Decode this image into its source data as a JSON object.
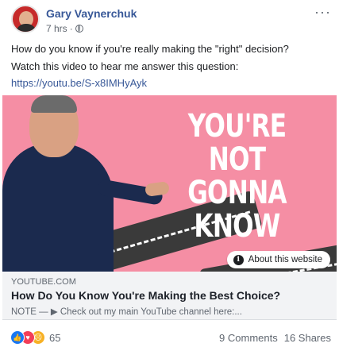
{
  "header": {
    "author": "Gary Vaynerchuk",
    "time": "7 hrs",
    "separator": "·",
    "more_label": "···"
  },
  "post": {
    "line1": "How do you know if you're really making the \"right\" decision?",
    "line2": "Watch this video to hear me answer this question:",
    "link": "https://youtu.be/S-x8IMHyAyk"
  },
  "media": {
    "overlay_text": [
      "YOU'RE",
      "NOT GONNA",
      "KNOW"
    ],
    "about_label": "About this website",
    "background_color": "#f58ea4"
  },
  "preview": {
    "domain": "YOUTUBE.COM",
    "title": "How Do You Know You're Making the Best Choice?",
    "description": "NOTE — ▶ Check out my main YouTube channel here:..."
  },
  "footer": {
    "reaction_icons": [
      "like-icon",
      "love-icon",
      "sad-icon"
    ],
    "reaction_count": "65",
    "comments": "9 Comments",
    "shares": "16 Shares"
  },
  "colors": {
    "link": "#385898",
    "like": "#1877f2",
    "love": "#f33e58",
    "sad": "#f7b125"
  }
}
